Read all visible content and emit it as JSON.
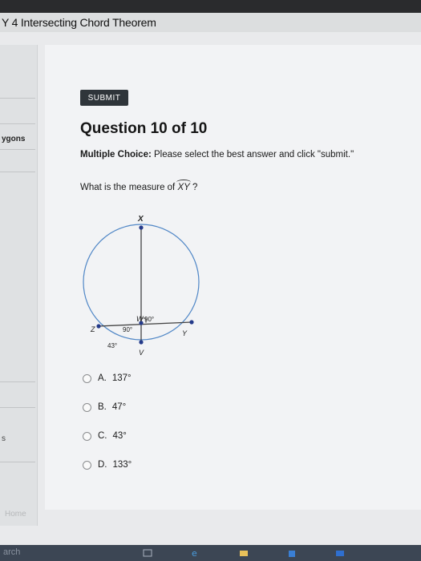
{
  "window": {
    "title": "Y 4  Intersecting Chord Theorem"
  },
  "left_panel": {
    "item_label": "ygons",
    "bottom_label": "s",
    "faded_label": "Home"
  },
  "toolbar": {
    "submit_label": "SUBMIT"
  },
  "question": {
    "title": "Question 10 of 10",
    "instruction_bold": "Multiple Choice:",
    "instruction_rest": " Please select the best answer and click \"submit.\"",
    "prompt_text": "What is the measure of ",
    "arc_name": "XY",
    "prompt_end": " ?"
  },
  "diagram": {
    "label_x": "X",
    "label_w": "W",
    "label_z": "Z",
    "label_y": "Y",
    "label_v": "V",
    "angle_top": "90°",
    "angle_mid": "90°",
    "arc_label": "43°",
    "colors": {
      "circle": "#4f86c6",
      "chord": "#444444",
      "point": "#243a8a"
    }
  },
  "choices": [
    {
      "letter": "A.",
      "text": "137°"
    },
    {
      "letter": "B.",
      "text": "47°"
    },
    {
      "letter": "C.",
      "text": "43°"
    },
    {
      "letter": "D.",
      "text": "133°"
    }
  ],
  "taskbar": {
    "search_text": "arch"
  }
}
